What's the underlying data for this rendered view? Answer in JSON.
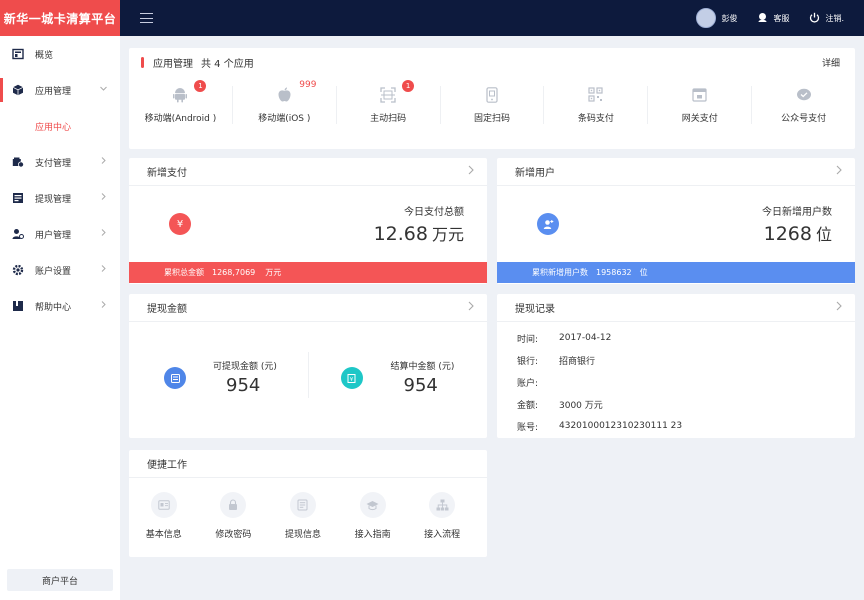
{
  "brand": {
    "title": "新华一城卡清算平台"
  },
  "sidebar": {
    "items": [
      {
        "label": "概览",
        "icon": "overview-icon"
      },
      {
        "label": "应用管理",
        "icon": "box-icon",
        "expanded": true
      },
      {
        "label": "支付管理",
        "icon": "payment-icon"
      },
      {
        "label": "提现管理",
        "icon": "withdraw-icon"
      },
      {
        "label": "用户管理",
        "icon": "user-manage-icon"
      },
      {
        "label": "账户设置",
        "icon": "gear-icon"
      },
      {
        "label": "帮助中心",
        "icon": "book-icon"
      }
    ],
    "sub_item": "应用中心",
    "merchant_button": "商户平台"
  },
  "topbar": {
    "user_name": "彭俊",
    "service_label": "客服",
    "logout_label": "注销."
  },
  "apps_card": {
    "title": "应用管理",
    "count_text": "共 4 个应用",
    "detail_link": "详细",
    "apps": [
      {
        "label": "移动端(Android )",
        "badge": "1"
      },
      {
        "label": "移动端(iOS )",
        "badge": "999"
      },
      {
        "label": "主动扫码",
        "badge": "1"
      },
      {
        "label": "固定扫码",
        "badge": ""
      },
      {
        "label": "条码支付",
        "badge": ""
      },
      {
        "label": "网关支付",
        "badge": ""
      },
      {
        "label": "公众号支付",
        "badge": ""
      }
    ]
  },
  "new_payment": {
    "title": "新增支付",
    "caption": "今日支付总额",
    "value": "12.68",
    "unit": "万元",
    "footer_label": "累积总金额",
    "footer_value": "1268,7069",
    "footer_unit": "万元",
    "color": "#f45556"
  },
  "new_users": {
    "title": "新增用户",
    "caption": "今日新增用户数",
    "value": "1268",
    "unit": "位",
    "footer_label": "累积新增用户数",
    "footer_value": "1958632",
    "footer_unit": "位",
    "color": "#5a8ef0"
  },
  "withdraw_amount": {
    "title": "提现金额",
    "available_caption": "可提现金额 (元)",
    "available_value": "954",
    "settling_caption": "结算中金额 (元)",
    "settling_value": "954"
  },
  "withdraw_record": {
    "title": "提现记录",
    "rows": [
      {
        "k": "时间:",
        "v": "2017-04-12"
      },
      {
        "k": "银行:",
        "v": "招商银行"
      },
      {
        "k": "账户:",
        "v": ""
      },
      {
        "k": "金额:",
        "v": "3000 万元"
      },
      {
        "k": "账号:",
        "v": "4320100012310230111 23"
      }
    ]
  },
  "quick_work": {
    "title": "便捷工作",
    "items": [
      {
        "label": "基本信息"
      },
      {
        "label": "修改密码"
      },
      {
        "label": "提现信息"
      },
      {
        "label": "接入指南"
      },
      {
        "label": "接入流程"
      }
    ]
  }
}
